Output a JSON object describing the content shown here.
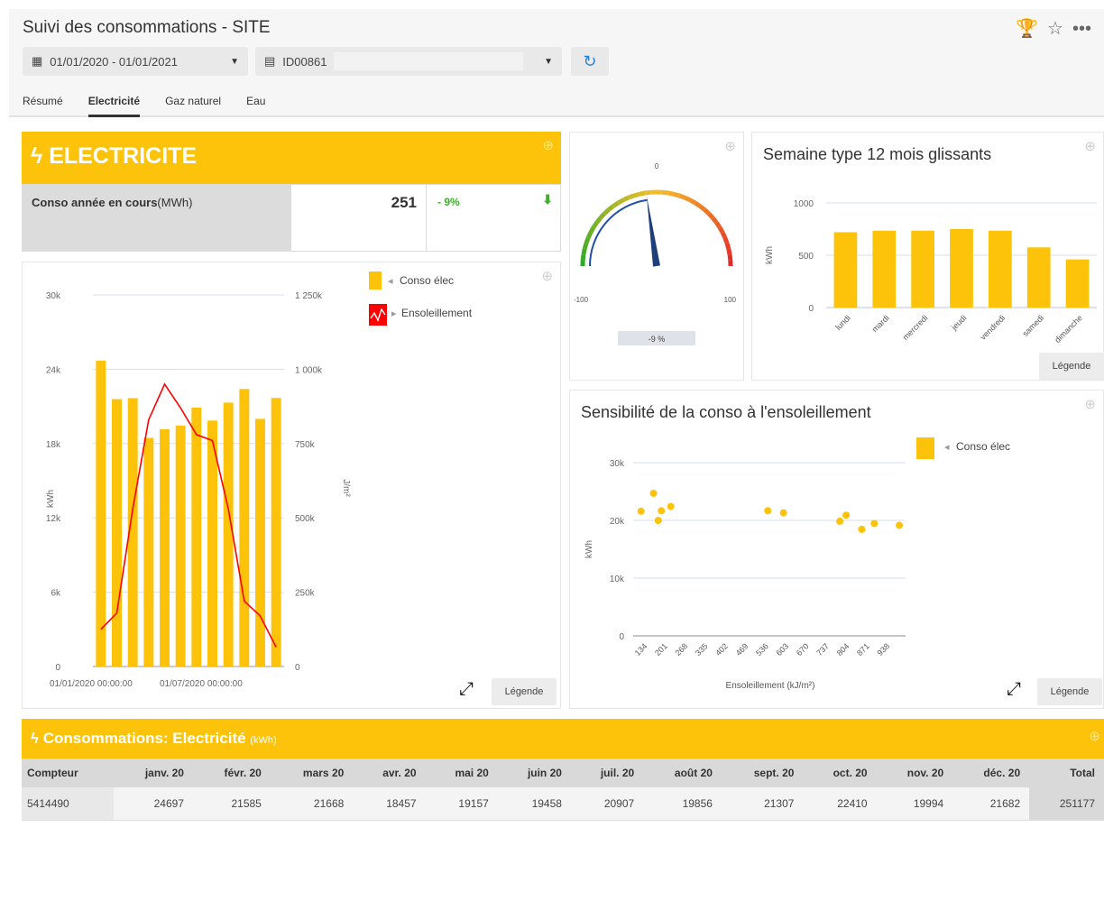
{
  "header": {
    "title": "Suivi des consommations - SITE",
    "date_range": "01/01/2020 - 01/01/2021",
    "site_id": "ID00861"
  },
  "tabs": [
    {
      "label": "Résumé",
      "active": false
    },
    {
      "label": "Electricité",
      "active": true
    },
    {
      "label": "Gaz naturel",
      "active": false
    },
    {
      "label": "Eau",
      "active": false
    }
  ],
  "kpi": {
    "title": "ELECTRICITE",
    "label": "Conso année en cours",
    "unit": "(MWh)",
    "value": "251",
    "delta": "- 9%"
  },
  "legend_button": "Légende",
  "chart_data": [
    {
      "type": "bar",
      "series": [
        {
          "name": "Conso élec",
          "type": "bar",
          "axis": "left",
          "values": [
            24697,
            21585,
            21668,
            18457,
            19157,
            19458,
            20907,
            19856,
            21307,
            22410,
            19994,
            21682
          ]
        },
        {
          "name": "Ensoleillement",
          "type": "line",
          "axis": "right",
          "values": [
            125,
            180,
            530,
            830,
            950,
            870,
            780,
            760,
            530,
            220,
            170,
            65
          ]
        }
      ],
      "ylabel": "kWh",
      "y2label": "J/m²",
      "ylim": [
        0,
        30000
      ],
      "y2lim": [
        0,
        1250
      ],
      "y_ticks": [
        "0",
        "6k",
        "12k",
        "18k",
        "24k",
        "30k"
      ],
      "y2_ticks": [
        "0",
        "250k",
        "500k",
        "750k",
        "1 000k",
        "1 250k"
      ],
      "x_tick_labels": [
        "01/01/2020 00:00:00",
        "01/07/2020 00:00:00"
      ],
      "legend": "top-right",
      "grid": true
    },
    {
      "type": "gauge",
      "value": -9,
      "min": -100,
      "max": 100,
      "labels": [
        "-100",
        "0",
        "100"
      ],
      "value_label": "-9 %"
    },
    {
      "type": "bar",
      "title": "Semaine type 12 mois glissants",
      "categories": [
        "lundi",
        "mardi",
        "mercredi",
        "jeudi",
        "vendredi",
        "samedi",
        "dimanche"
      ],
      "values": [
        720,
        735,
        735,
        750,
        735,
        575,
        460
      ],
      "ylabel": "kWh",
      "ylim": [
        0,
        1000
      ],
      "y_ticks": [
        "0",
        "500",
        "1000"
      ],
      "grid": true
    },
    {
      "type": "scatter",
      "title": "Sensibilité de la conso à l'ensoleillement",
      "series": [
        {
          "name": "Conso élec",
          "points": [
            [
              125,
              21585
            ],
            [
              165,
              24697
            ],
            [
              180,
              19994
            ],
            [
              190,
              21668
            ],
            [
              220,
              22410
            ],
            [
              530,
              21682
            ],
            [
              580,
              21307
            ],
            [
              760,
              19856
            ],
            [
              780,
              20907
            ],
            [
              830,
              18457
            ],
            [
              870,
              19458
            ],
            [
              950,
              19157
            ]
          ]
        }
      ],
      "xlabel": "Ensoleillement (kJ/m²)",
      "ylabel": "kWh",
      "xlim": [
        100,
        970
      ],
      "ylim": [
        0,
        30000
      ],
      "x_ticks": [
        "134",
        "201",
        "268",
        "335",
        "402",
        "469",
        "536",
        "603",
        "670",
        "737",
        "804",
        "871",
        "938"
      ],
      "y_ticks": [
        "0",
        "10k",
        "20k",
        "30k"
      ],
      "legend": "top-right",
      "grid": true
    },
    {
      "type": "table",
      "title": "Consommations: Electricité",
      "unit": "(kWh)",
      "columns": [
        "Compteur",
        "janv. 20",
        "févr. 20",
        "mars 20",
        "avr. 20",
        "mai 20",
        "juin 20",
        "juil. 20",
        "août 20",
        "sept. 20",
        "oct. 20",
        "nov. 20",
        "déc. 20",
        "Total"
      ],
      "rows": [
        [
          "5414490",
          "24697",
          "21585",
          "21668",
          "18457",
          "19157",
          "19458",
          "20907",
          "19856",
          "21307",
          "22410",
          "19994",
          "21682",
          "251177"
        ]
      ]
    }
  ],
  "colors": {
    "accent": "#fcc30a",
    "line": "#ff0000",
    "positive": "#3fae2a",
    "refresh": "#2d7fd3"
  }
}
